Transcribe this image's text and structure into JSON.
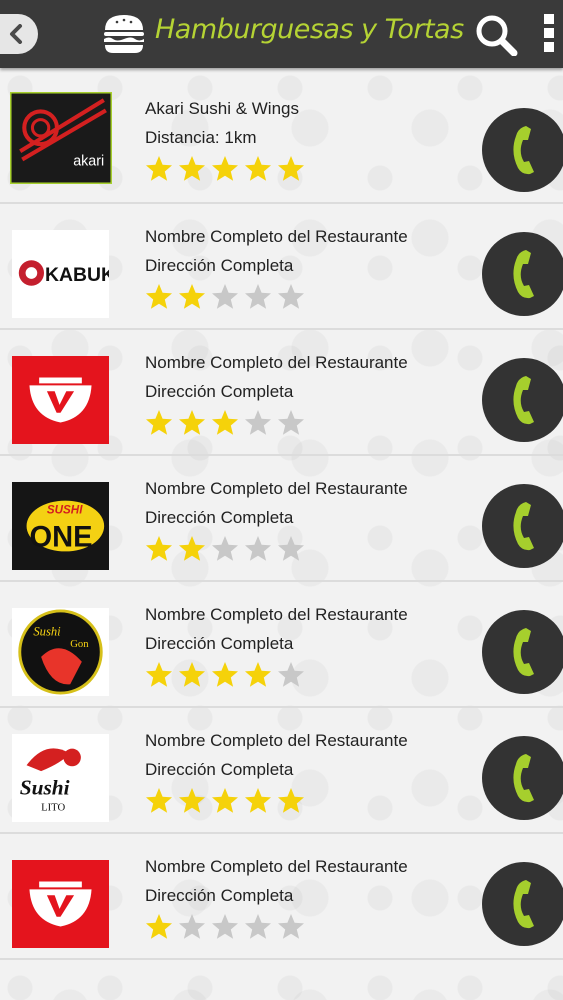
{
  "header": {
    "title": "Hamburguesas y Tortas",
    "accent_color": "#b5d334",
    "icons": [
      "back-arrow-icon",
      "burger-icon",
      "search-icon",
      "more-vert-icon"
    ]
  },
  "restaurants": [
    {
      "name": "Akari Sushi & Wings",
      "detail": "Distancia: 1km",
      "rating": 5,
      "logo_text": "akari",
      "logo": "akari-logo"
    },
    {
      "name": "Nombre  Completo del Restaurante",
      "detail": "Dirección Completa",
      "rating": 2,
      "logo_text": "KABUKI",
      "logo": "kabuki-logo"
    },
    {
      "name": "Nombre  Completo del Restaurante",
      "detail": "Dirección Completa",
      "rating": 3,
      "logo_text": "",
      "logo": "red-bowl-logo"
    },
    {
      "name": "Nombre  Completo del Restaurante",
      "detail": "Dirección Completa",
      "rating": 2,
      "logo_text": "SUSHI ONE",
      "logo": "sushi-one-logo"
    },
    {
      "name": "Nombre  Completo del Restaurante",
      "detail": "Dirección Completa",
      "rating": 4,
      "logo_text": "Sushi Gon",
      "logo": "sushi-gon-logo"
    },
    {
      "name": "Nombre  Completo del Restaurante",
      "detail": "Dirección Completa",
      "rating": 5,
      "logo_text": "Sushi Lito",
      "logo": "sushi-lito-logo"
    },
    {
      "name": "Nombre  Completo del Restaurante",
      "detail": "Dirección Completa",
      "rating": 1,
      "logo_text": "",
      "logo": "red-bowl-logo"
    }
  ],
  "colors": {
    "star_on": "#f5d20a",
    "star_off": "#c8c8c8",
    "call_icon": "#a6cf2d"
  }
}
